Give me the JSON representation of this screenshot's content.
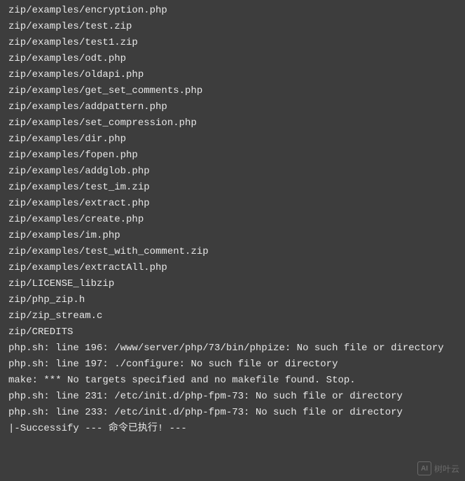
{
  "terminal": {
    "lines": [
      "zip/examples/encryption.php",
      "zip/examples/test.zip",
      "zip/examples/test1.zip",
      "zip/examples/odt.php",
      "zip/examples/oldapi.php",
      "zip/examples/get_set_comments.php",
      "zip/examples/addpattern.php",
      "zip/examples/set_compression.php",
      "zip/examples/dir.php",
      "zip/examples/fopen.php",
      "zip/examples/addglob.php",
      "zip/examples/test_im.zip",
      "zip/examples/extract.php",
      "zip/examples/create.php",
      "zip/examples/im.php",
      "zip/examples/test_with_comment.zip",
      "zip/examples/extractAll.php",
      "zip/LICENSE_libzip",
      "zip/php_zip.h",
      "zip/zip_stream.c",
      "zip/CREDITS",
      "php.sh: line 196: /www/server/php/73/bin/phpize: No such file or directory",
      "php.sh: line 197: ./configure: No such file or directory",
      "make: *** No targets specified and no makefile found. Stop.",
      "php.sh: line 231: /etc/init.d/php-fpm-73: No such file or directory",
      "php.sh: line 233: /etc/init.d/php-fpm-73: No such file or directory",
      "|-Successify --- 命令已执行! ---"
    ]
  },
  "watermark": {
    "icon_text": "AI",
    "label": "树叶云"
  }
}
